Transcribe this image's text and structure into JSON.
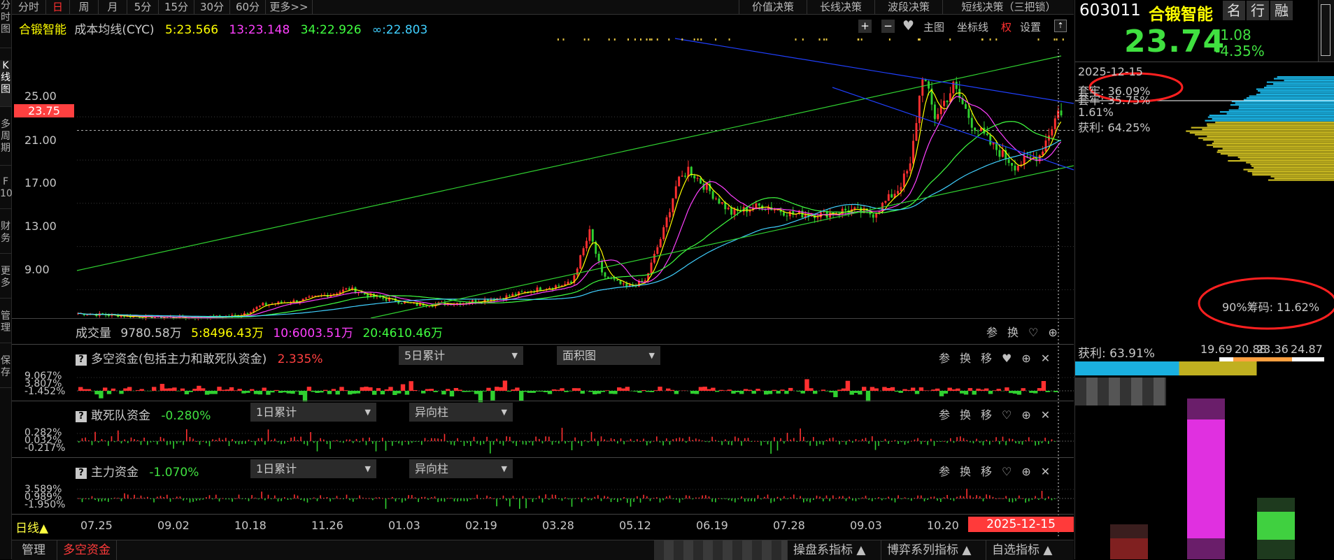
{
  "left_sidebar": {
    "items": [
      "分\n时\n图",
      "K\n线\n图",
      "多\n周\n期",
      "F\n10",
      "财\n务",
      "更\n多",
      "管\n理",
      "保\n存"
    ]
  },
  "toolbar": {
    "periods": [
      "分时",
      "日",
      "周",
      "月",
      "5分",
      "15分",
      "30分",
      "60分",
      "更多>>"
    ],
    "active_period": "日",
    "right_buttons": [
      "价值决策",
      "长线决策",
      "波段决策",
      "短线决策（三把锁）"
    ]
  },
  "main_chart": {
    "stock_name": "合锻智能",
    "indicator": "成本均线(CYC)",
    "ma5": "5:23.566",
    "ma13": "13:23.148",
    "ma34": "34:22.926",
    "ma_inf": "∞:22.803",
    "tools": [
      "主图",
      "坐标线",
      "权",
      "设置"
    ],
    "price_tag": "23.75",
    "y_ticks": [
      "25.00",
      "21.00",
      "17.00",
      "13.00",
      "9.00"
    ],
    "colors": {
      "ma5": "#ffff00",
      "ma13": "#ff40ff",
      "ma34": "#40ff40",
      "ma_inf": "#40d0ff",
      "up": "#ff3030",
      "down": "#30d030"
    }
  },
  "volume": {
    "label": "成交量",
    "value": "9780.58万",
    "ma5": "5:8496.43万",
    "ma10": "10:6003.51万",
    "ma20": "20:4610.46万"
  },
  "panel_tools_full": [
    "参",
    "换",
    "移"
  ],
  "panel_tools_short": [
    "参",
    "换"
  ],
  "panels": [
    {
      "title": "多空资金(包括主力和敢死队资金)",
      "value": "2.335%",
      "mode": "5日累计",
      "style": "面积图",
      "ticks": [
        "9.067%",
        "3.807%",
        "-1.452%"
      ]
    },
    {
      "title": "敢死队资金",
      "value": "-0.280%",
      "mode": "1日累计",
      "style": "异向柱",
      "ticks": [
        "0.282%",
        "0.032%",
        "-0.217%"
      ]
    },
    {
      "title": "主力资金",
      "value": "-1.070%",
      "mode": "1日累计",
      "style": "异向柱",
      "ticks": [
        "3.589%",
        "0.989%",
        "-1.950%"
      ]
    }
  ],
  "x_axis": {
    "period_label": "日线▲",
    "dates": [
      "07.25",
      "09.02",
      "10.18",
      "11.26",
      "01.03",
      "02.19",
      "03.28",
      "05.12",
      "06.19",
      "07.28",
      "09.03",
      "10.20"
    ],
    "cursor_date": "2025-12-15"
  },
  "bottom_bar": {
    "tabs": [
      "管理",
      "多空资金"
    ],
    "active_tab": "多空资金",
    "right_items": [
      "操盘系指标 ▲",
      "博弈系列指标 ▲",
      "自选指标 ▲"
    ]
  },
  "right_panel": {
    "code": "603011",
    "name": "合锻智能",
    "buttons": [
      "名",
      "行",
      "融"
    ],
    "price": "23.74",
    "change": "-1.08",
    "change_pct": "-4.35%",
    "date": "2025-12-15",
    "locked1": "套牢: 36.09%",
    "locked2": "套牢: 35.75%",
    "pct_small": "1.61%",
    "profit1": "获利: 64.25%",
    "chips90": "90%筹码: 11.62%",
    "range_low": "19.69",
    "range_mid": "20.88",
    "range_mid2": "23.36",
    "range_high": "24.87",
    "profit2": "获利: 63.91%"
  }
}
